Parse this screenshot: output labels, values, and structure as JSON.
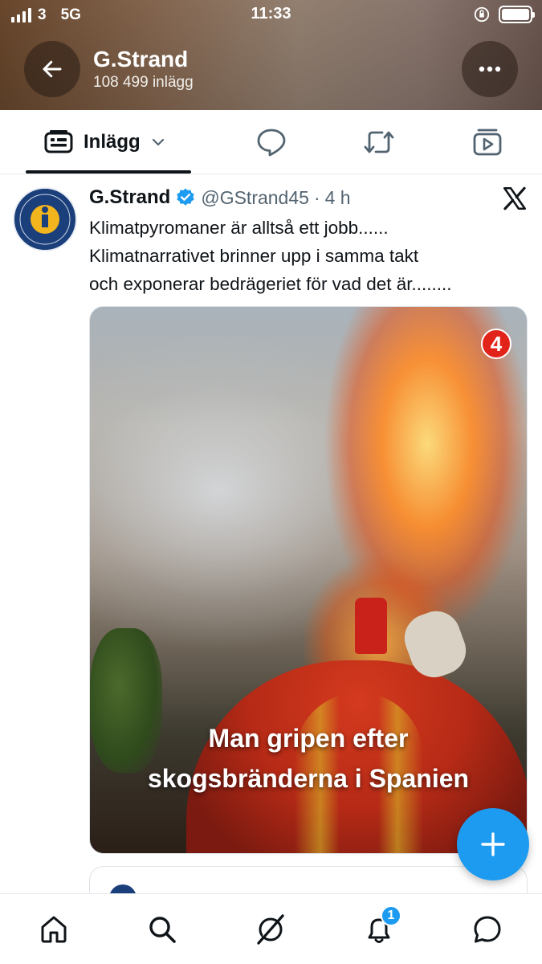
{
  "status_bar": {
    "carrier": "3",
    "network": "5G",
    "time": "11:33"
  },
  "profile": {
    "name": "G.Strand",
    "post_count": "108 499 inlägg"
  },
  "tabs": [
    {
      "label": "Inlägg",
      "icon": "posts-icon",
      "selected": true
    },
    {
      "label": "",
      "icon": "replies-icon",
      "selected": false
    },
    {
      "label": "",
      "icon": "repost-icon",
      "selected": false
    },
    {
      "label": "",
      "icon": "media-icon",
      "selected": false
    }
  ],
  "tweet": {
    "author_name": "G.Strand",
    "verified": true,
    "handle": "@GStrand45",
    "separator": "·",
    "time": "4 h",
    "text_lines": [
      "Klimatpyromaner är alltså ett jobb......",
      "Klimatnarrativet brinner upp i samma takt",
      "och exponerar bedrägeriet för vad det är........"
    ],
    "media": {
      "badge": "4",
      "caption_lines": [
        "Man gripen efter",
        "skogsbränderna i Spanien"
      ]
    }
  },
  "bottom_nav": {
    "items": [
      "home-icon",
      "search-icon",
      "grok-icon",
      "notifications-icon",
      "messages-icon"
    ],
    "notification_count": "1"
  },
  "colors": {
    "accent": "#1d9bf0",
    "text_primary": "#0f1419",
    "text_secondary": "#536471"
  }
}
